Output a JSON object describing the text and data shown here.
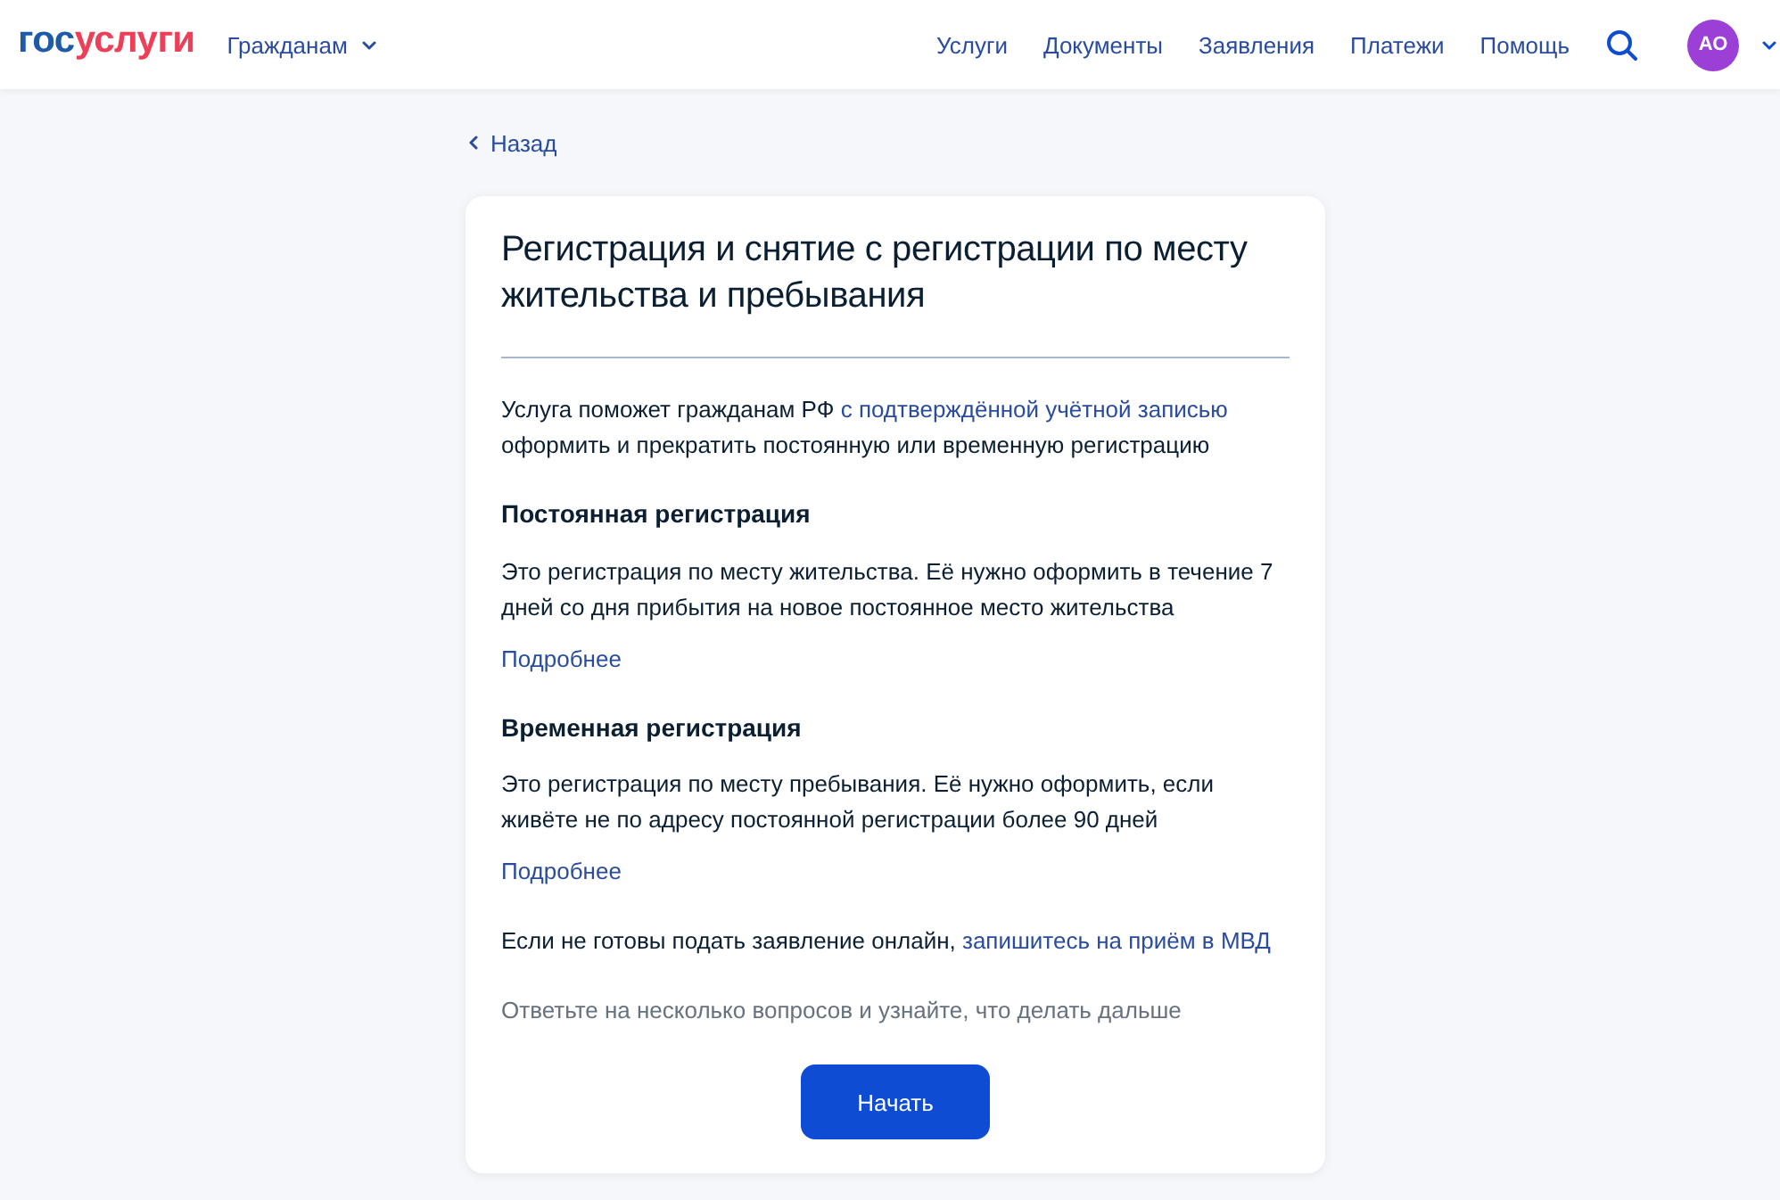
{
  "header": {
    "logo": {
      "part_1": "гос",
      "part_2": "услуги"
    },
    "audience_menu": "Гражданам",
    "nav": [
      "Услуги",
      "Документы",
      "Заявления",
      "Платежи",
      "Помощь"
    ],
    "avatar": {
      "initials": "АО"
    }
  },
  "back_link": "Назад",
  "card": {
    "title": "Регистрация и снятие с регистрации по месту жительства и пребывания",
    "intro": {
      "before": "Услуга поможет гражданам РФ",
      "link": "с подтверждённой учётной записью",
      "after": "оформить и прекратить постоянную или временную регистрацию"
    },
    "sections": [
      {
        "heading": "Постоянная регистрация",
        "text": "Это регистрация по месту жительства. Её нужно оформить в течение 7 дней со дня прибытия на новое постоянное место жительства",
        "more_link": "Подробнее"
      },
      {
        "heading": "Временная регистрация",
        "text": "Это регистрация по месту пребывания. Её нужно оформить, если живёте не по адресу постоянной регистрации более 90 дней",
        "more_link": "Подробнее"
      }
    ],
    "offline_note": {
      "before": "Если не готовы подать заявление онлайн,",
      "link": "запишитесь на приём в МВД"
    },
    "hint": "Ответьте на несколько вопросов и узнайте, что делать дальше",
    "start_button": "Начать"
  }
}
